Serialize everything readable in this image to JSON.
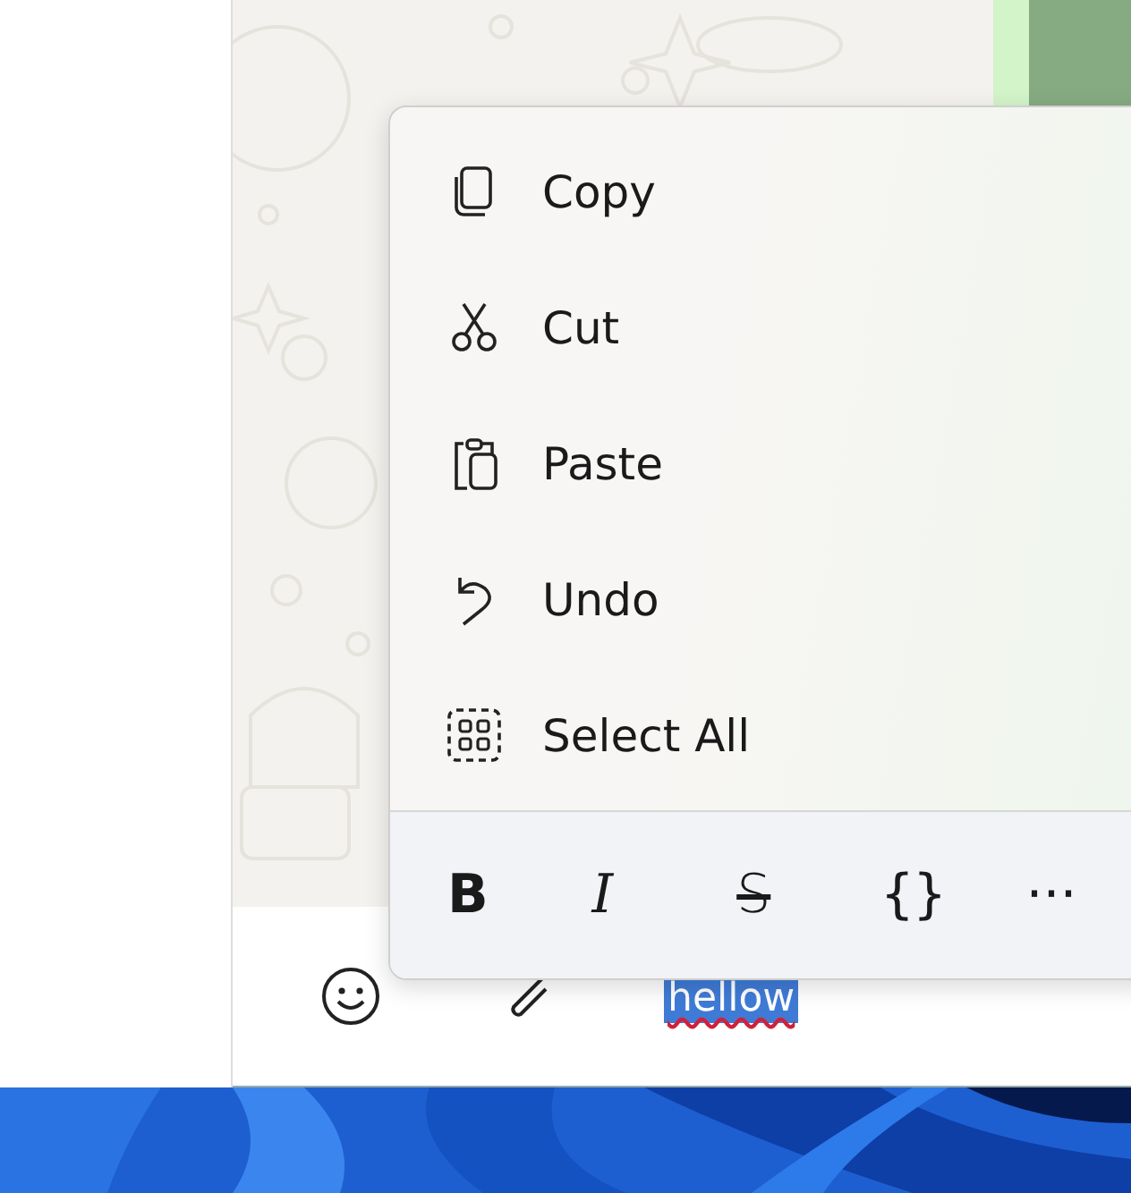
{
  "context_menu": {
    "items": [
      {
        "label": "Copy",
        "kind": "copy"
      },
      {
        "label": "Cut",
        "kind": "cut"
      },
      {
        "label": "Paste",
        "kind": "paste"
      },
      {
        "label": "Undo",
        "kind": "undo"
      },
      {
        "label": "Select All",
        "kind": "select_all"
      }
    ],
    "format_tools": [
      {
        "label": "B",
        "kind": "bold"
      },
      {
        "label": "I",
        "kind": "italic"
      },
      {
        "label": "S",
        "kind": "strikethrough"
      },
      {
        "label": "{}",
        "kind": "code"
      },
      {
        "label": "···",
        "kind": "more"
      }
    ]
  },
  "composer": {
    "value": "hellow",
    "selected": true,
    "misspelled": true
  }
}
